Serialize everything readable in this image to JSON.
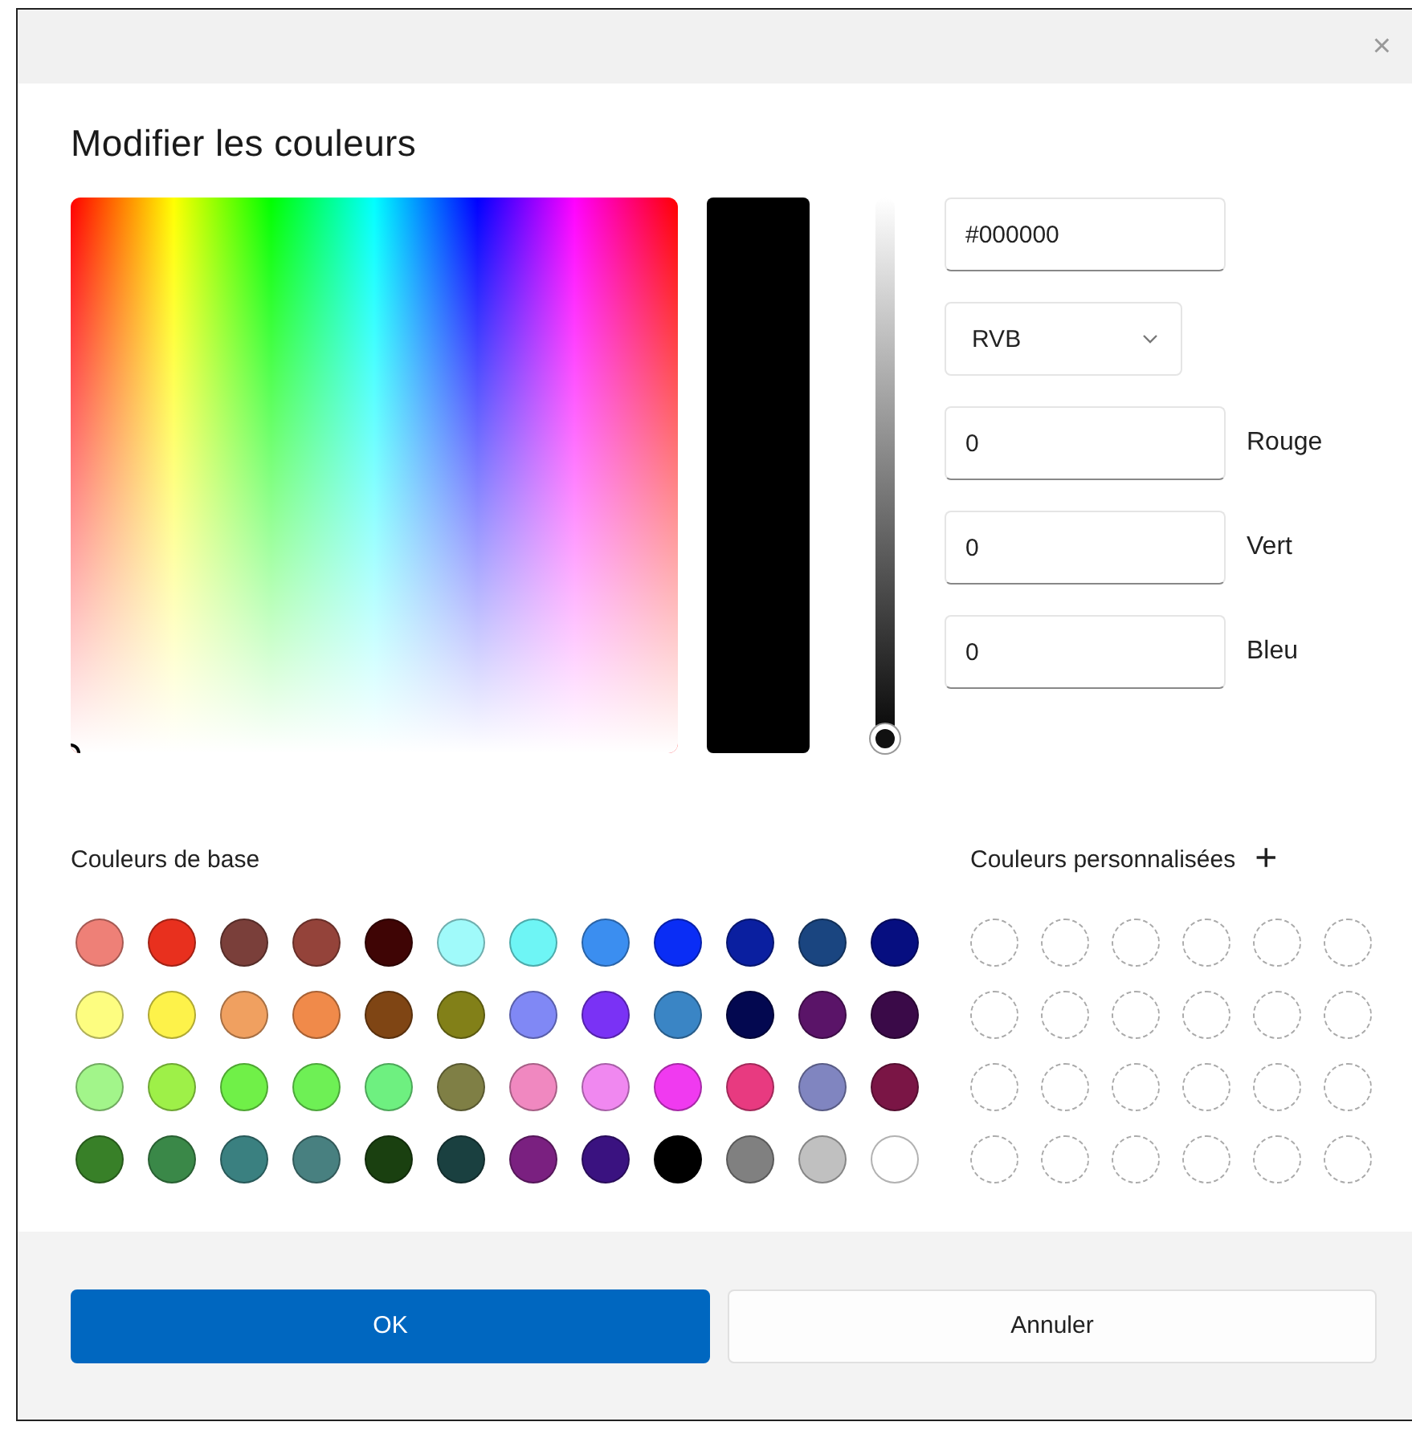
{
  "window": {
    "close": "×"
  },
  "title": "Modifier les couleurs",
  "brightness": {
    "level": 0
  },
  "hex_field": {
    "value": "#000000"
  },
  "mode_dropdown": {
    "value": "RVB"
  },
  "channels": [
    {
      "value": "0",
      "label": "Rouge"
    },
    {
      "value": "0",
      "label": "Vert"
    },
    {
      "value": "0",
      "label": "Bleu"
    }
  ],
  "base_colors": {
    "label": "Couleurs de base",
    "swatches": [
      {
        "color": "#ee8077"
      },
      {
        "color": "#e8301e"
      },
      {
        "color": "#7a3f3a"
      },
      {
        "color": "#94433a"
      },
      {
        "color": "#3f0505"
      },
      {
        "color": "#a0fafa"
      },
      {
        "color": "#6ef5f5"
      },
      {
        "color": "#3b8ef0"
      },
      {
        "color": "#0a2df5"
      },
      {
        "color": "#0a1fa0"
      },
      {
        "color": "#1a4580"
      },
      {
        "color": "#060e80"
      },
      {
        "color": "#fdfd80"
      },
      {
        "color": "#fdf24a"
      },
      {
        "color": "#f0a060"
      },
      {
        "color": "#f08a4a"
      },
      {
        "color": "#7f4514"
      },
      {
        "color": "#828018"
      },
      {
        "color": "#8088f5"
      },
      {
        "color": "#7a32f5"
      },
      {
        "color": "#3a85c5"
      },
      {
        "color": "#030850"
      },
      {
        "color": "#5a1468"
      },
      {
        "color": "#3a0a48"
      },
      {
        "color": "#a2f58a"
      },
      {
        "color": "#9ef048"
      },
      {
        "color": "#70f048"
      },
      {
        "color": "#6ef055"
      },
      {
        "color": "#6ef080"
      },
      {
        "color": "#7f7f45"
      },
      {
        "color": "#f088c0"
      },
      {
        "color": "#f088f0"
      },
      {
        "color": "#f03af0"
      },
      {
        "color": "#e83a80"
      },
      {
        "color": "#8085c0"
      },
      {
        "color": "#7a1545"
      },
      {
        "color": "#388028"
      },
      {
        "color": "#3a8848"
      },
      {
        "color": "#3a8080"
      },
      {
        "color": "#488080"
      },
      {
        "color": "#1a4010"
      },
      {
        "color": "#1a4040"
      },
      {
        "color": "#7a2080"
      },
      {
        "color": "#3a1280"
      },
      {
        "color": "#000000"
      },
      {
        "color": "#808080"
      },
      {
        "color": "#c0c0c0"
      },
      {
        "color": "#ffffff"
      }
    ]
  },
  "custom_colors": {
    "label": "Couleurs personnalisées",
    "add": "+",
    "slots": [
      {
        "filled": false
      },
      {
        "filled": false
      },
      {
        "filled": false
      },
      {
        "filled": false
      },
      {
        "filled": false
      },
      {
        "filled": false
      },
      {
        "filled": false
      },
      {
        "filled": false
      },
      {
        "filled": false
      },
      {
        "filled": false
      },
      {
        "filled": false
      },
      {
        "filled": false
      },
      {
        "filled": false
      },
      {
        "filled": false
      },
      {
        "filled": false
      },
      {
        "filled": false
      },
      {
        "filled": false
      },
      {
        "filled": false
      },
      {
        "filled": false
      },
      {
        "filled": false
      },
      {
        "filled": false
      },
      {
        "filled": false
      },
      {
        "filled": false
      },
      {
        "filled": false
      }
    ]
  },
  "buttons": [
    {
      "label": "OK",
      "kind": "primary"
    },
    {
      "label": "Annuler",
      "kind": "secondary"
    }
  ]
}
